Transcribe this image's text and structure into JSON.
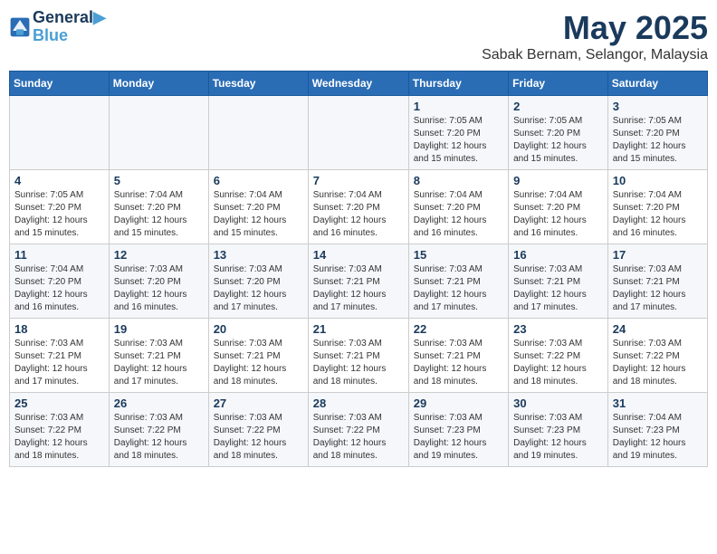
{
  "logo": {
    "line1": "General",
    "line2": "Blue"
  },
  "title": "May 2025",
  "subtitle": "Sabak Bernam, Selangor, Malaysia",
  "weekdays": [
    "Sunday",
    "Monday",
    "Tuesday",
    "Wednesday",
    "Thursday",
    "Friday",
    "Saturday"
  ],
  "weeks": [
    [
      {
        "day": "",
        "info": ""
      },
      {
        "day": "",
        "info": ""
      },
      {
        "day": "",
        "info": ""
      },
      {
        "day": "",
        "info": ""
      },
      {
        "day": "1",
        "info": "Sunrise: 7:05 AM\nSunset: 7:20 PM\nDaylight: 12 hours\nand 15 minutes."
      },
      {
        "day": "2",
        "info": "Sunrise: 7:05 AM\nSunset: 7:20 PM\nDaylight: 12 hours\nand 15 minutes."
      },
      {
        "day": "3",
        "info": "Sunrise: 7:05 AM\nSunset: 7:20 PM\nDaylight: 12 hours\nand 15 minutes."
      }
    ],
    [
      {
        "day": "4",
        "info": "Sunrise: 7:05 AM\nSunset: 7:20 PM\nDaylight: 12 hours\nand 15 minutes."
      },
      {
        "day": "5",
        "info": "Sunrise: 7:04 AM\nSunset: 7:20 PM\nDaylight: 12 hours\nand 15 minutes."
      },
      {
        "day": "6",
        "info": "Sunrise: 7:04 AM\nSunset: 7:20 PM\nDaylight: 12 hours\nand 15 minutes."
      },
      {
        "day": "7",
        "info": "Sunrise: 7:04 AM\nSunset: 7:20 PM\nDaylight: 12 hours\nand 16 minutes."
      },
      {
        "day": "8",
        "info": "Sunrise: 7:04 AM\nSunset: 7:20 PM\nDaylight: 12 hours\nand 16 minutes."
      },
      {
        "day": "9",
        "info": "Sunrise: 7:04 AM\nSunset: 7:20 PM\nDaylight: 12 hours\nand 16 minutes."
      },
      {
        "day": "10",
        "info": "Sunrise: 7:04 AM\nSunset: 7:20 PM\nDaylight: 12 hours\nand 16 minutes."
      }
    ],
    [
      {
        "day": "11",
        "info": "Sunrise: 7:04 AM\nSunset: 7:20 PM\nDaylight: 12 hours\nand 16 minutes."
      },
      {
        "day": "12",
        "info": "Sunrise: 7:03 AM\nSunset: 7:20 PM\nDaylight: 12 hours\nand 16 minutes."
      },
      {
        "day": "13",
        "info": "Sunrise: 7:03 AM\nSunset: 7:20 PM\nDaylight: 12 hours\nand 17 minutes."
      },
      {
        "day": "14",
        "info": "Sunrise: 7:03 AM\nSunset: 7:21 PM\nDaylight: 12 hours\nand 17 minutes."
      },
      {
        "day": "15",
        "info": "Sunrise: 7:03 AM\nSunset: 7:21 PM\nDaylight: 12 hours\nand 17 minutes."
      },
      {
        "day": "16",
        "info": "Sunrise: 7:03 AM\nSunset: 7:21 PM\nDaylight: 12 hours\nand 17 minutes."
      },
      {
        "day": "17",
        "info": "Sunrise: 7:03 AM\nSunset: 7:21 PM\nDaylight: 12 hours\nand 17 minutes."
      }
    ],
    [
      {
        "day": "18",
        "info": "Sunrise: 7:03 AM\nSunset: 7:21 PM\nDaylight: 12 hours\nand 17 minutes."
      },
      {
        "day": "19",
        "info": "Sunrise: 7:03 AM\nSunset: 7:21 PM\nDaylight: 12 hours\nand 17 minutes."
      },
      {
        "day": "20",
        "info": "Sunrise: 7:03 AM\nSunset: 7:21 PM\nDaylight: 12 hours\nand 18 minutes."
      },
      {
        "day": "21",
        "info": "Sunrise: 7:03 AM\nSunset: 7:21 PM\nDaylight: 12 hours\nand 18 minutes."
      },
      {
        "day": "22",
        "info": "Sunrise: 7:03 AM\nSunset: 7:21 PM\nDaylight: 12 hours\nand 18 minutes."
      },
      {
        "day": "23",
        "info": "Sunrise: 7:03 AM\nSunset: 7:22 PM\nDaylight: 12 hours\nand 18 minutes."
      },
      {
        "day": "24",
        "info": "Sunrise: 7:03 AM\nSunset: 7:22 PM\nDaylight: 12 hours\nand 18 minutes."
      }
    ],
    [
      {
        "day": "25",
        "info": "Sunrise: 7:03 AM\nSunset: 7:22 PM\nDaylight: 12 hours\nand 18 minutes."
      },
      {
        "day": "26",
        "info": "Sunrise: 7:03 AM\nSunset: 7:22 PM\nDaylight: 12 hours\nand 18 minutes."
      },
      {
        "day": "27",
        "info": "Sunrise: 7:03 AM\nSunset: 7:22 PM\nDaylight: 12 hours\nand 18 minutes."
      },
      {
        "day": "28",
        "info": "Sunrise: 7:03 AM\nSunset: 7:22 PM\nDaylight: 12 hours\nand 18 minutes."
      },
      {
        "day": "29",
        "info": "Sunrise: 7:03 AM\nSunset: 7:23 PM\nDaylight: 12 hours\nand 19 minutes."
      },
      {
        "day": "30",
        "info": "Sunrise: 7:03 AM\nSunset: 7:23 PM\nDaylight: 12 hours\nand 19 minutes."
      },
      {
        "day": "31",
        "info": "Sunrise: 7:04 AM\nSunset: 7:23 PM\nDaylight: 12 hours\nand 19 minutes."
      }
    ]
  ]
}
